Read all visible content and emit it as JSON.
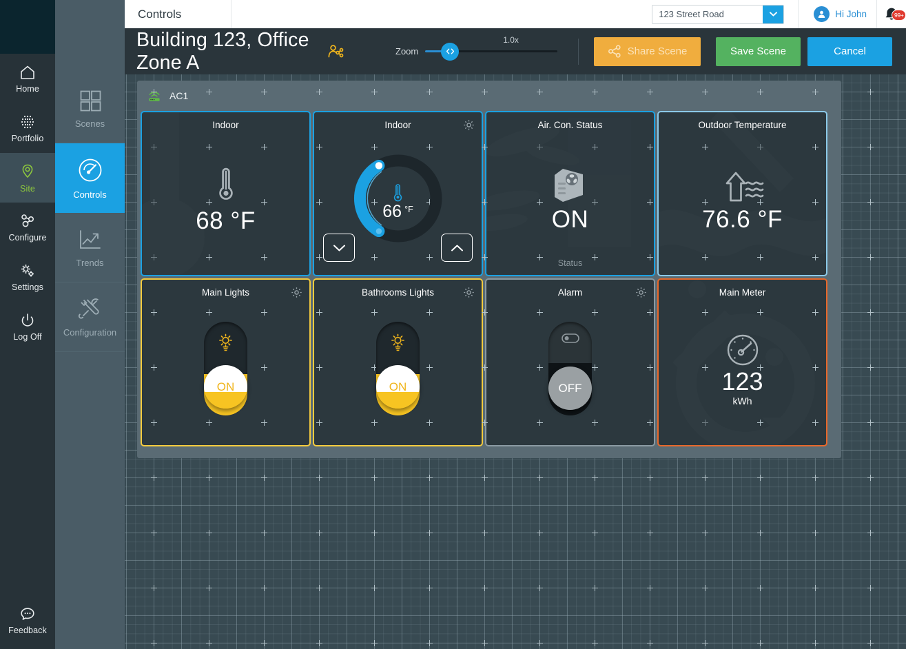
{
  "left_rail": {
    "logo": "app-logo",
    "items": [
      {
        "label": "Home",
        "icon": "home-icon",
        "active": false
      },
      {
        "label": "Portfolio",
        "icon": "portfolio-dots-icon",
        "active": false
      },
      {
        "label": "Site",
        "icon": "map-pin-icon",
        "active": true
      },
      {
        "label": "Configure",
        "icon": "nodes-icon",
        "active": false
      },
      {
        "label": "Settings",
        "icon": "gears-icon",
        "active": false
      },
      {
        "label": "Log Off",
        "icon": "power-icon",
        "active": false
      }
    ],
    "feedback": {
      "label": "Feedback",
      "icon": "chat-bubble-icon"
    }
  },
  "module_tabs": [
    {
      "label": "Scenes",
      "icon": "grid-squares-icon",
      "active": false
    },
    {
      "label": "Controls",
      "icon": "gauge-icon",
      "active": true
    },
    {
      "label": "Trends",
      "icon": "line-chart-icon",
      "active": false
    },
    {
      "label": "Configuration",
      "icon": "tools-icon",
      "active": false
    }
  ],
  "top_bar": {
    "breadcrumb": "Controls",
    "site_select": {
      "value": "123 Street Road",
      "caret_icon": "chevron-down-icon"
    },
    "user": {
      "greeting": "Hi John",
      "avatar_icon": "user-avatar-icon"
    },
    "notifications": {
      "icon": "bell-icon",
      "badge": "99+"
    }
  },
  "toolbar": {
    "scene_title": "Building 123, Office Zone A",
    "scene_share_icon": "share-user-icon",
    "zoom": {
      "label": "Zoom",
      "value": "1.0x",
      "handle_icon": "left-right-arrows-icon"
    },
    "share_scene": {
      "label": "Share Scene",
      "icon": "share-nodes-icon"
    },
    "save_scene": {
      "label": "Save Scene"
    },
    "cancel": {
      "label": "Cancel"
    }
  },
  "panel": {
    "title": "AC1",
    "status_icon": "router-signal-icon",
    "cards": [
      {
        "title": "Indoor",
        "type": "readout",
        "value": "68",
        "unit": "°F",
        "icon": "thermometer-icon",
        "border": "blue",
        "has_gear": false,
        "footer": ""
      },
      {
        "title": "Indoor",
        "type": "dial",
        "value": "66",
        "unit": "°F",
        "icon": "thermometer-icon",
        "border": "blue",
        "has_gear": true,
        "gear_icon": "gear-icon",
        "step_down_icon": "chevron-down-icon",
        "step_up_icon": "chevron-up-icon",
        "footer": ""
      },
      {
        "title": "Air. Con. Status",
        "type": "readout",
        "value": "ON",
        "unit": "",
        "icon": "ac-unit-icon",
        "border": "blue",
        "has_gear": false,
        "footer": "Status"
      },
      {
        "title": "Outdoor Temperature",
        "type": "readout",
        "value": "76.6",
        "unit": "°F",
        "icon": "outdoor-temp-icon",
        "border": "lblue",
        "has_gear": false,
        "footer": ""
      },
      {
        "title": "Main Lights",
        "type": "toggle",
        "state": "ON",
        "icon": "light-bulb-icon",
        "border": "yellow",
        "has_gear": true,
        "gear_icon": "gear-icon",
        "footer": ""
      },
      {
        "title": "Bathrooms Lights",
        "type": "toggle",
        "state": "ON",
        "icon": "light-bulb-icon",
        "border": "yellow",
        "has_gear": true,
        "gear_icon": "gear-icon",
        "footer": ""
      },
      {
        "title": "Alarm",
        "type": "toggle",
        "state": "OFF",
        "icon": "switch-icon",
        "border": "grey",
        "has_gear": true,
        "gear_icon": "gear-icon",
        "footer": ""
      },
      {
        "title": "Main Meter",
        "type": "meter",
        "value": "123",
        "unit": "kWh",
        "icon": "speedometer-icon",
        "border": "orange",
        "has_gear": false,
        "footer": ""
      }
    ]
  },
  "colors": {
    "accent_blue": "#1ba1e2",
    "yellow": "#f5cb3d",
    "green": "#54b260",
    "orange": "#e8682a",
    "share_amber": "#f0ad3e",
    "site_green": "#8cc63e",
    "badge_red": "#e03a2f",
    "canvas_bg": "#384a52",
    "panel_bg": "#5a6b74",
    "card_bg": "#2c383e"
  }
}
